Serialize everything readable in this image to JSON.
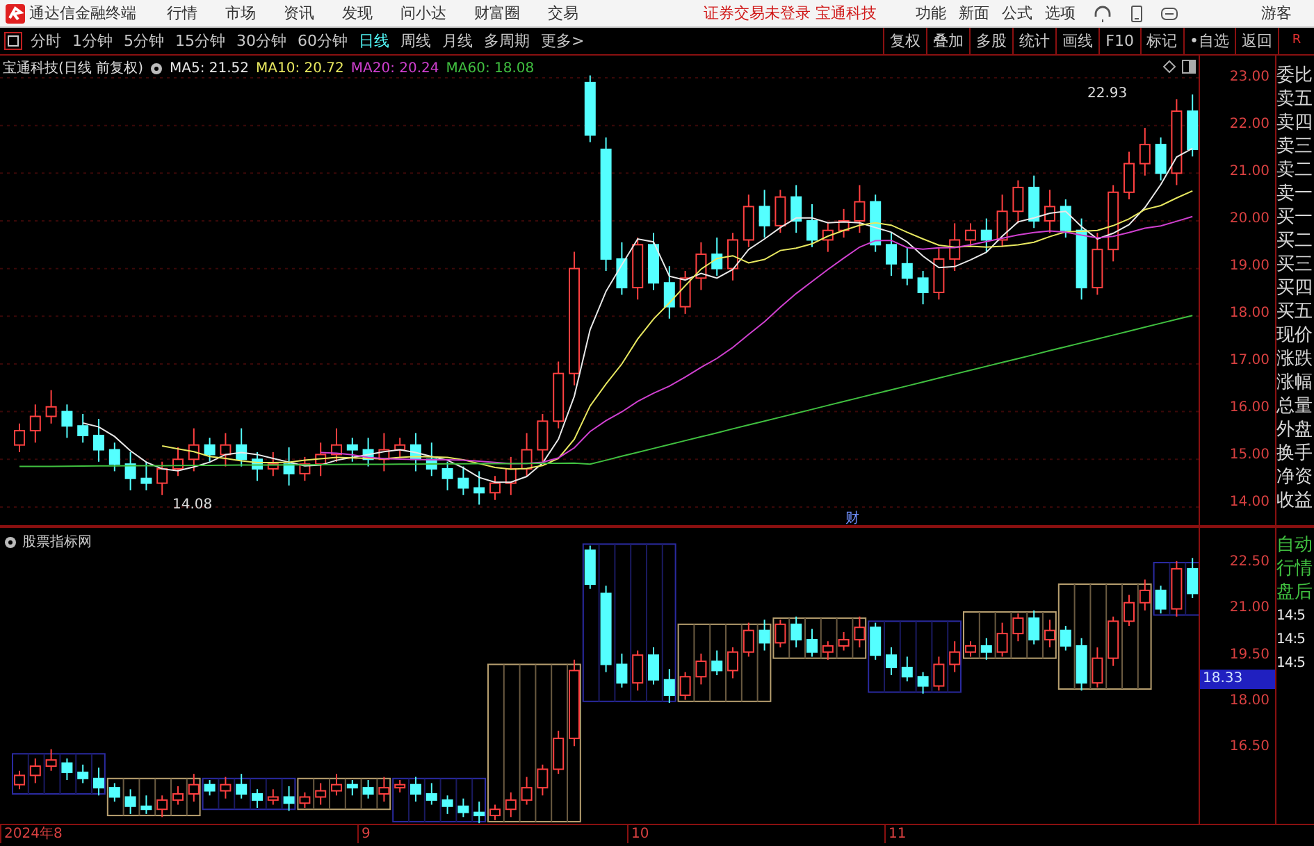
{
  "title_bar": {
    "app_name": "通达信金融终端",
    "menu": [
      "行情",
      "市场",
      "资讯",
      "发现",
      "问小达",
      "财富圈",
      "交易"
    ],
    "notice": "证券交易未登录",
    "stock": "宝通科技",
    "tools": [
      "功能",
      "新面",
      "公式",
      "选项"
    ],
    "user": "游客"
  },
  "period_bar": {
    "periods": [
      {
        "label": "分时",
        "selected": false
      },
      {
        "label": "1分钟",
        "selected": false
      },
      {
        "label": "5分钟",
        "selected": false
      },
      {
        "label": "15分钟",
        "selected": false
      },
      {
        "label": "30分钟",
        "selected": false
      },
      {
        "label": "60分钟",
        "selected": false
      },
      {
        "label": "日线",
        "selected": true
      },
      {
        "label": "周线",
        "selected": false
      },
      {
        "label": "月线",
        "selected": false
      },
      {
        "label": "多周期",
        "selected": false
      },
      {
        "label": "更多>",
        "selected": false
      }
    ],
    "actions": [
      "复权",
      "叠加",
      "多股",
      "统计",
      "画线",
      "F10",
      "标记",
      "•自选",
      "返回"
    ],
    "corner": "R"
  },
  "main_chart": {
    "legend": {
      "title": "宝通科技(日线 前复权)",
      "averages": [
        {
          "label": "MA5: 21.52",
          "color": "#e8e8e8"
        },
        {
          "label": "MA10: 20.72",
          "color": "#e8e860"
        },
        {
          "label": "MA20: 20.24",
          "color": "#d040d0"
        },
        {
          "label": "MA60: 18.08",
          "color": "#40c040"
        }
      ]
    },
    "price_ticks": [
      "23.00",
      "22.00",
      "21.00",
      "20.00",
      "19.00",
      "18.00",
      "17.00",
      "16.00",
      "15.00",
      "14.00"
    ],
    "high_label": "22.93",
    "low_label": "14.08",
    "marker": "财"
  },
  "indicator_chart": {
    "title": "股票指标网",
    "price_ticks": [
      "22.50",
      "21.00",
      "19.50",
      "18.00",
      "16.50"
    ],
    "current_price": "18.33"
  },
  "date_axis": [
    "2024年8",
    "9",
    "10",
    "11"
  ],
  "quote_panel": {
    "labels": [
      "委比",
      "卖五",
      "卖四",
      "卖三",
      "卖二",
      "卖一",
      "买一",
      "买二",
      "买三",
      "买四",
      "买五",
      "现价",
      "涨跌",
      "涨幅",
      "总量",
      "外盘",
      "换手",
      "净资",
      "收益"
    ],
    "mode_labels": [
      "自动",
      "行情",
      "盘后"
    ],
    "times": [
      "14:5",
      "14:5",
      "14:5"
    ]
  }
}
